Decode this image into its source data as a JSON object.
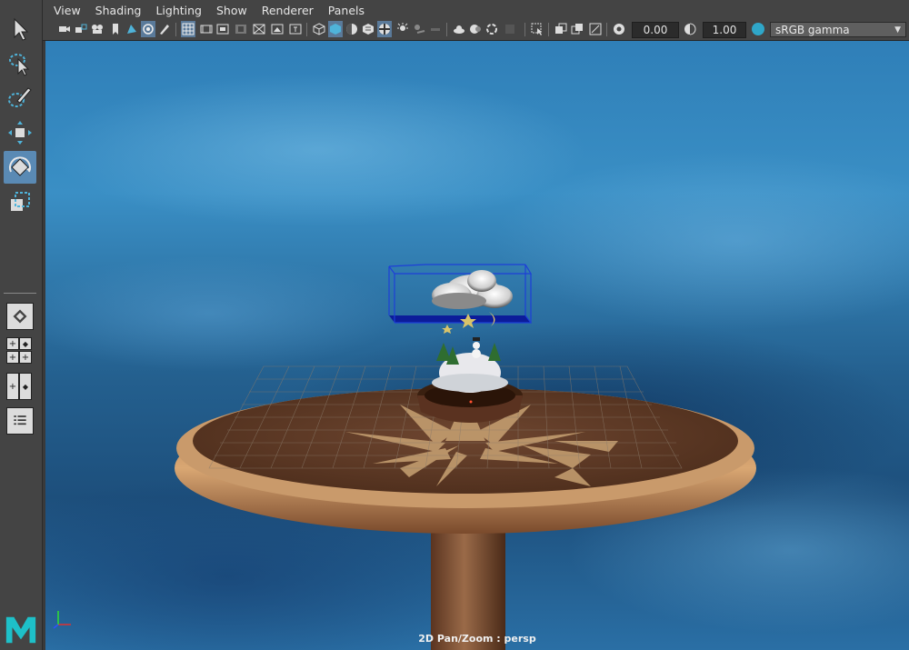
{
  "menubar": {
    "menus": [
      "View",
      "Shading",
      "Lighting",
      "Show",
      "Renderer",
      "Panels"
    ]
  },
  "toolbar": {
    "exposure_value": "0.00",
    "gamma_value": "1.00",
    "colorspace": "sRGB gamma",
    "colorspace_toggle_label": "ON"
  },
  "viewport": {
    "panel_label": "2D Pan/Zoom : persp"
  },
  "colors": {
    "accent": "#5a8ab4",
    "selection_box": "#1d3fd8",
    "axis_x": "#e03030",
    "axis_y": "#30e030",
    "axis_z": "#3050ff",
    "logo": "#1ec0c8"
  },
  "icons": {
    "tools": [
      "select-arrow-icon",
      "lasso-select-icon",
      "paint-select-icon",
      "move-tool-icon",
      "rotate-tool-icon",
      "scale-tool-icon"
    ],
    "layout": [
      "single-pane-icon",
      "four-pane-icon",
      "two-pane-icon",
      "outliner-icon"
    ]
  }
}
